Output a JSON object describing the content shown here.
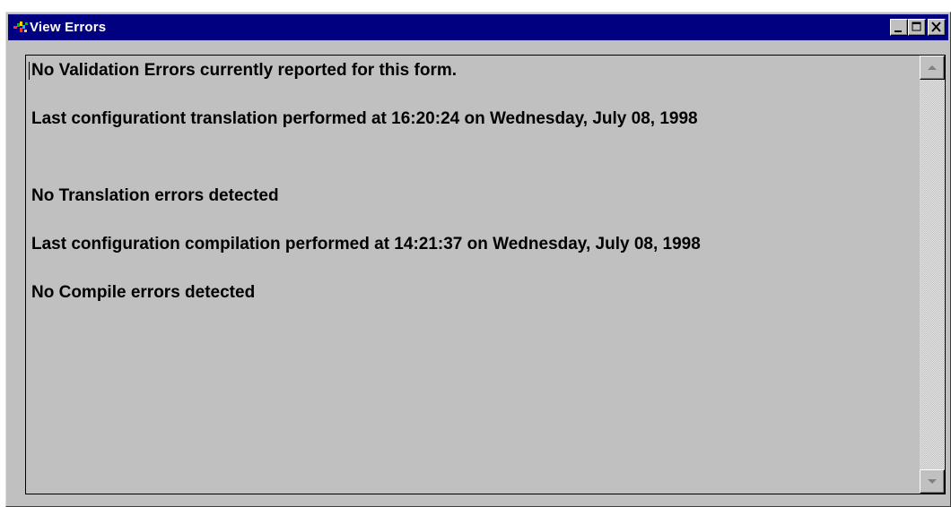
{
  "window": {
    "title": "View Errors",
    "title_bar_color": "#000080",
    "face_color": "#c0c0c0",
    "icon": "app-colorful-icon",
    "controls": [
      "minimize-icon",
      "maximize-icon",
      "close-icon"
    ]
  },
  "report": {
    "lines": [
      "No Validation Errors currently reported for this form.",
      "Last configurationt translation performed at 16:20:24 on Wednesday, July 08, 1998",
      "No Translation errors detected",
      "Last configuration compilation performed at 14:21:37 on Wednesday, July 08, 1998",
      "No Compile errors detected"
    ]
  },
  "scrollbar": {
    "up_icon": "scroll-up-arrow-icon",
    "down_icon": "scroll-down-arrow-icon"
  }
}
